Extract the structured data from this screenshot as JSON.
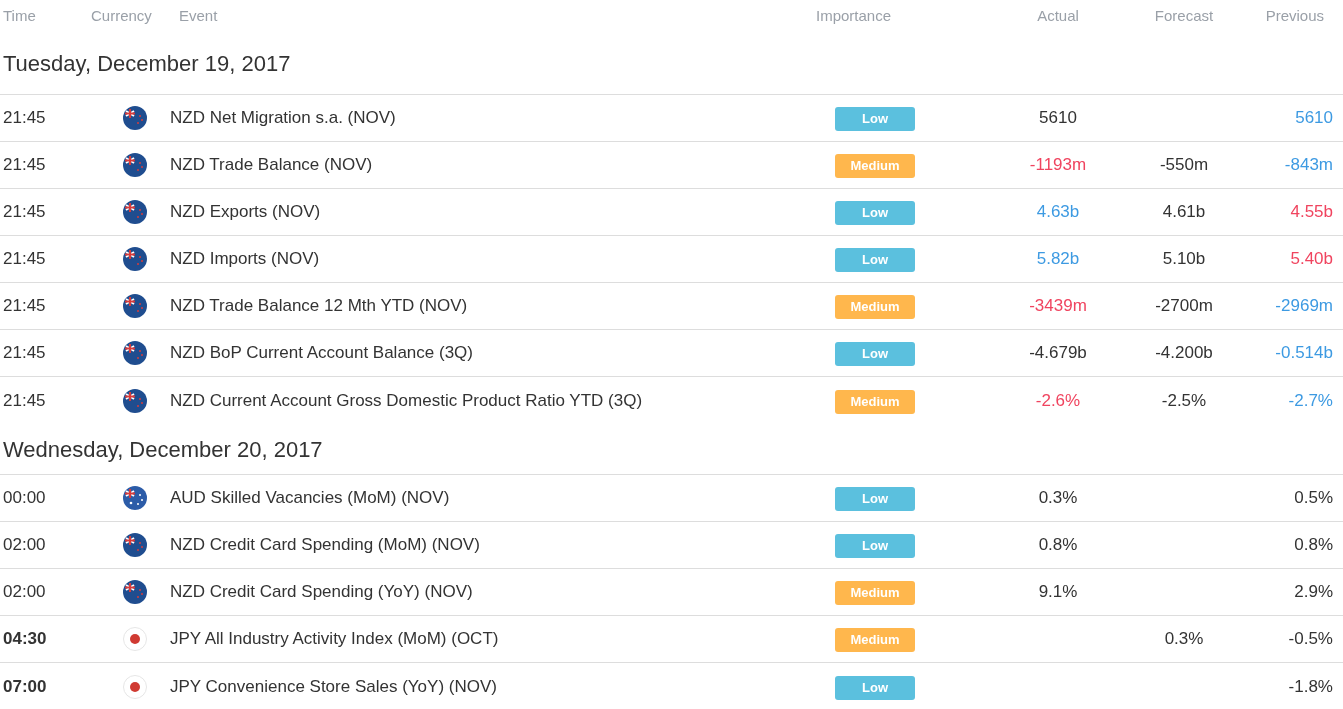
{
  "columns": [
    "Time",
    "Currency",
    "Event",
    "Importance",
    "Actual",
    "Forecast",
    "Previous"
  ],
  "days": [
    {
      "date": "Tuesday, December 19, 2017",
      "events": [
        {
          "time": "21:45",
          "emphasis": false,
          "kind": "nz",
          "event": "NZD Net Migration s.a. (NOV)",
          "importance": {
            "label": "Low",
            "kind": "low"
          },
          "actual": {
            "text": "5610",
            "kind": "neutral"
          },
          "previous": {
            "text": "5610",
            "kind": "up"
          }
        },
        {
          "time": "21:45",
          "emphasis": false,
          "kind": "nz",
          "event": "NZD Trade Balance (NOV)",
          "importance": {
            "label": "Medium",
            "kind": "medium"
          },
          "actual": {
            "text": "-1193m",
            "kind": "down"
          },
          "forecast": "-550m",
          "previous": {
            "text": "-843m",
            "kind": "up"
          }
        },
        {
          "time": "21:45",
          "emphasis": false,
          "kind": "nz",
          "event": "NZD Exports (NOV)",
          "importance": {
            "label": "Low",
            "kind": "low"
          },
          "actual": {
            "text": "4.63b",
            "kind": "up"
          },
          "forecast": "4.61b",
          "previous": {
            "text": "4.55b",
            "kind": "down"
          }
        },
        {
          "time": "21:45",
          "emphasis": false,
          "kind": "nz",
          "event": "NZD Imports (NOV)",
          "importance": {
            "label": "Low",
            "kind": "low"
          },
          "actual": {
            "text": "5.82b",
            "kind": "up"
          },
          "forecast": "5.10b",
          "previous": {
            "text": "5.40b",
            "kind": "down"
          }
        },
        {
          "time": "21:45",
          "emphasis": false,
          "kind": "nz",
          "event": "NZD Trade Balance 12 Mth YTD (NOV)",
          "importance": {
            "label": "Medium",
            "kind": "medium"
          },
          "actual": {
            "text": "-3439m",
            "kind": "down"
          },
          "forecast": "-2700m",
          "previous": {
            "text": "-2969m",
            "kind": "up"
          }
        },
        {
          "time": "21:45",
          "emphasis": false,
          "kind": "nz",
          "event": "NZD BoP Current Account Balance (3Q)",
          "importance": {
            "label": "Low",
            "kind": "low"
          },
          "actual": {
            "text": "-4.679b",
            "kind": "neutral"
          },
          "forecast": "-4.200b",
          "previous": {
            "text": "-0.514b",
            "kind": "up"
          }
        },
        {
          "time": "21:45",
          "emphasis": false,
          "kind": "nz",
          "event": "NZD Current Account Gross Domestic Product Ratio YTD (3Q)",
          "importance": {
            "label": "Medium",
            "kind": "medium"
          },
          "actual": {
            "text": "-2.6%",
            "kind": "down"
          },
          "forecast": "-2.5%",
          "previous": {
            "text": "-2.7%",
            "kind": "up"
          }
        }
      ]
    },
    {
      "date": "Wednesday, December 20, 2017",
      "events": [
        {
          "time": "00:00",
          "emphasis": false,
          "kind": "au",
          "event": "AUD Skilled Vacancies (MoM) (NOV)",
          "importance": {
            "label": "Low",
            "kind": "low"
          },
          "actual": {
            "text": "0.3%",
            "kind": "neutral"
          },
          "previous": {
            "text": "0.5%",
            "kind": "neutral"
          }
        },
        {
          "time": "02:00",
          "emphasis": false,
          "kind": "nz",
          "event": "NZD Credit Card Spending (MoM) (NOV)",
          "importance": {
            "label": "Low",
            "kind": "low"
          },
          "actual": {
            "text": "0.8%",
            "kind": "neutral"
          },
          "previous": {
            "text": "0.8%",
            "kind": "neutral"
          }
        },
        {
          "time": "02:00",
          "emphasis": false,
          "kind": "nz",
          "event": "NZD Credit Card Spending (YoY) (NOV)",
          "importance": {
            "label": "Medium",
            "kind": "medium"
          },
          "actual": {
            "text": "9.1%",
            "kind": "neutral"
          },
          "previous": {
            "text": "2.9%",
            "kind": "neutral"
          }
        },
        {
          "time": "04:30",
          "emphasis": true,
          "kind": "jp",
          "event": "JPY All Industry Activity Index (MoM) (OCT)",
          "importance": {
            "label": "Medium",
            "kind": "medium"
          },
          "forecast": "0.3%",
          "previous": {
            "text": "-0.5%",
            "kind": "neutral"
          }
        },
        {
          "time": "07:00",
          "emphasis": true,
          "kind": "jp",
          "event": "JPY Convenience Store Sales (YoY) (NOV)",
          "importance": {
            "label": "Low",
            "kind": "low"
          },
          "previous": {
            "text": "-1.8%",
            "kind": "neutral"
          }
        }
      ]
    }
  ]
}
